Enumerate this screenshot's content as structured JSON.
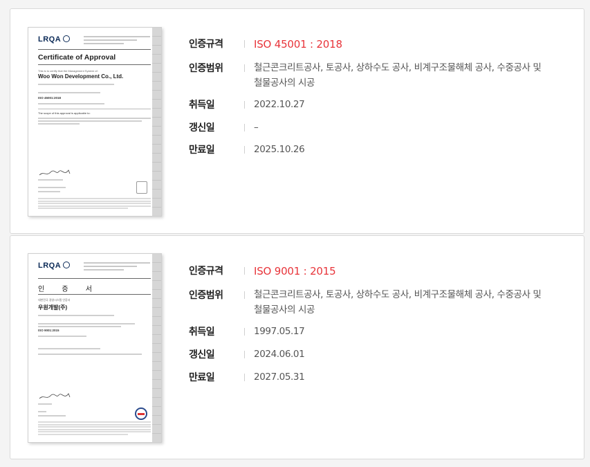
{
  "labels": {
    "standard": "인증규격",
    "scope": "인증범위",
    "acquired": "취득일",
    "renewed": "갱신일",
    "expires": "만료일"
  },
  "certificates": [
    {
      "standard": "ISO 45001 : 2018",
      "scope": "철근콘크리트공사, 토공사, 상하수도 공사, 비계구조물해체 공사, 수중공사 및 철물공사의 시공",
      "acquired": "2022.10.27",
      "renewed": "–",
      "expires": "2025.10.26",
      "thumbnail": {
        "logo": "LRQA",
        "title": "Certificate of Approval",
        "company": "Woo Won Development Co., Ltd.",
        "standard_text": "ISO 45001:2018",
        "intro": "This is to certify that the Management System of:",
        "scope_heading": "The scope of this approval is applicable to:"
      }
    },
    {
      "standard": "ISO 9001 : 2015",
      "scope": "철근콘크리트공사, 토공사, 상하수도 공사, 비계구조물해체 공사, 수중공사 및 철물공사의 시공",
      "acquired": "1997.05.17",
      "renewed": "2024.06.01",
      "expires": "2027.05.31",
      "thumbnail": {
        "logo": "LRQA",
        "title": "인 증 서",
        "company": "우원개발(주)",
        "standard_text": "ISO 9001:2015",
        "intro": "대한민국 경영시스템 인증서",
        "scope_heading": ""
      }
    }
  ],
  "colors": {
    "accent_red": "#e8343a",
    "label": "#222222",
    "value": "#555555",
    "lrqa_navy": "#0b2a57"
  }
}
